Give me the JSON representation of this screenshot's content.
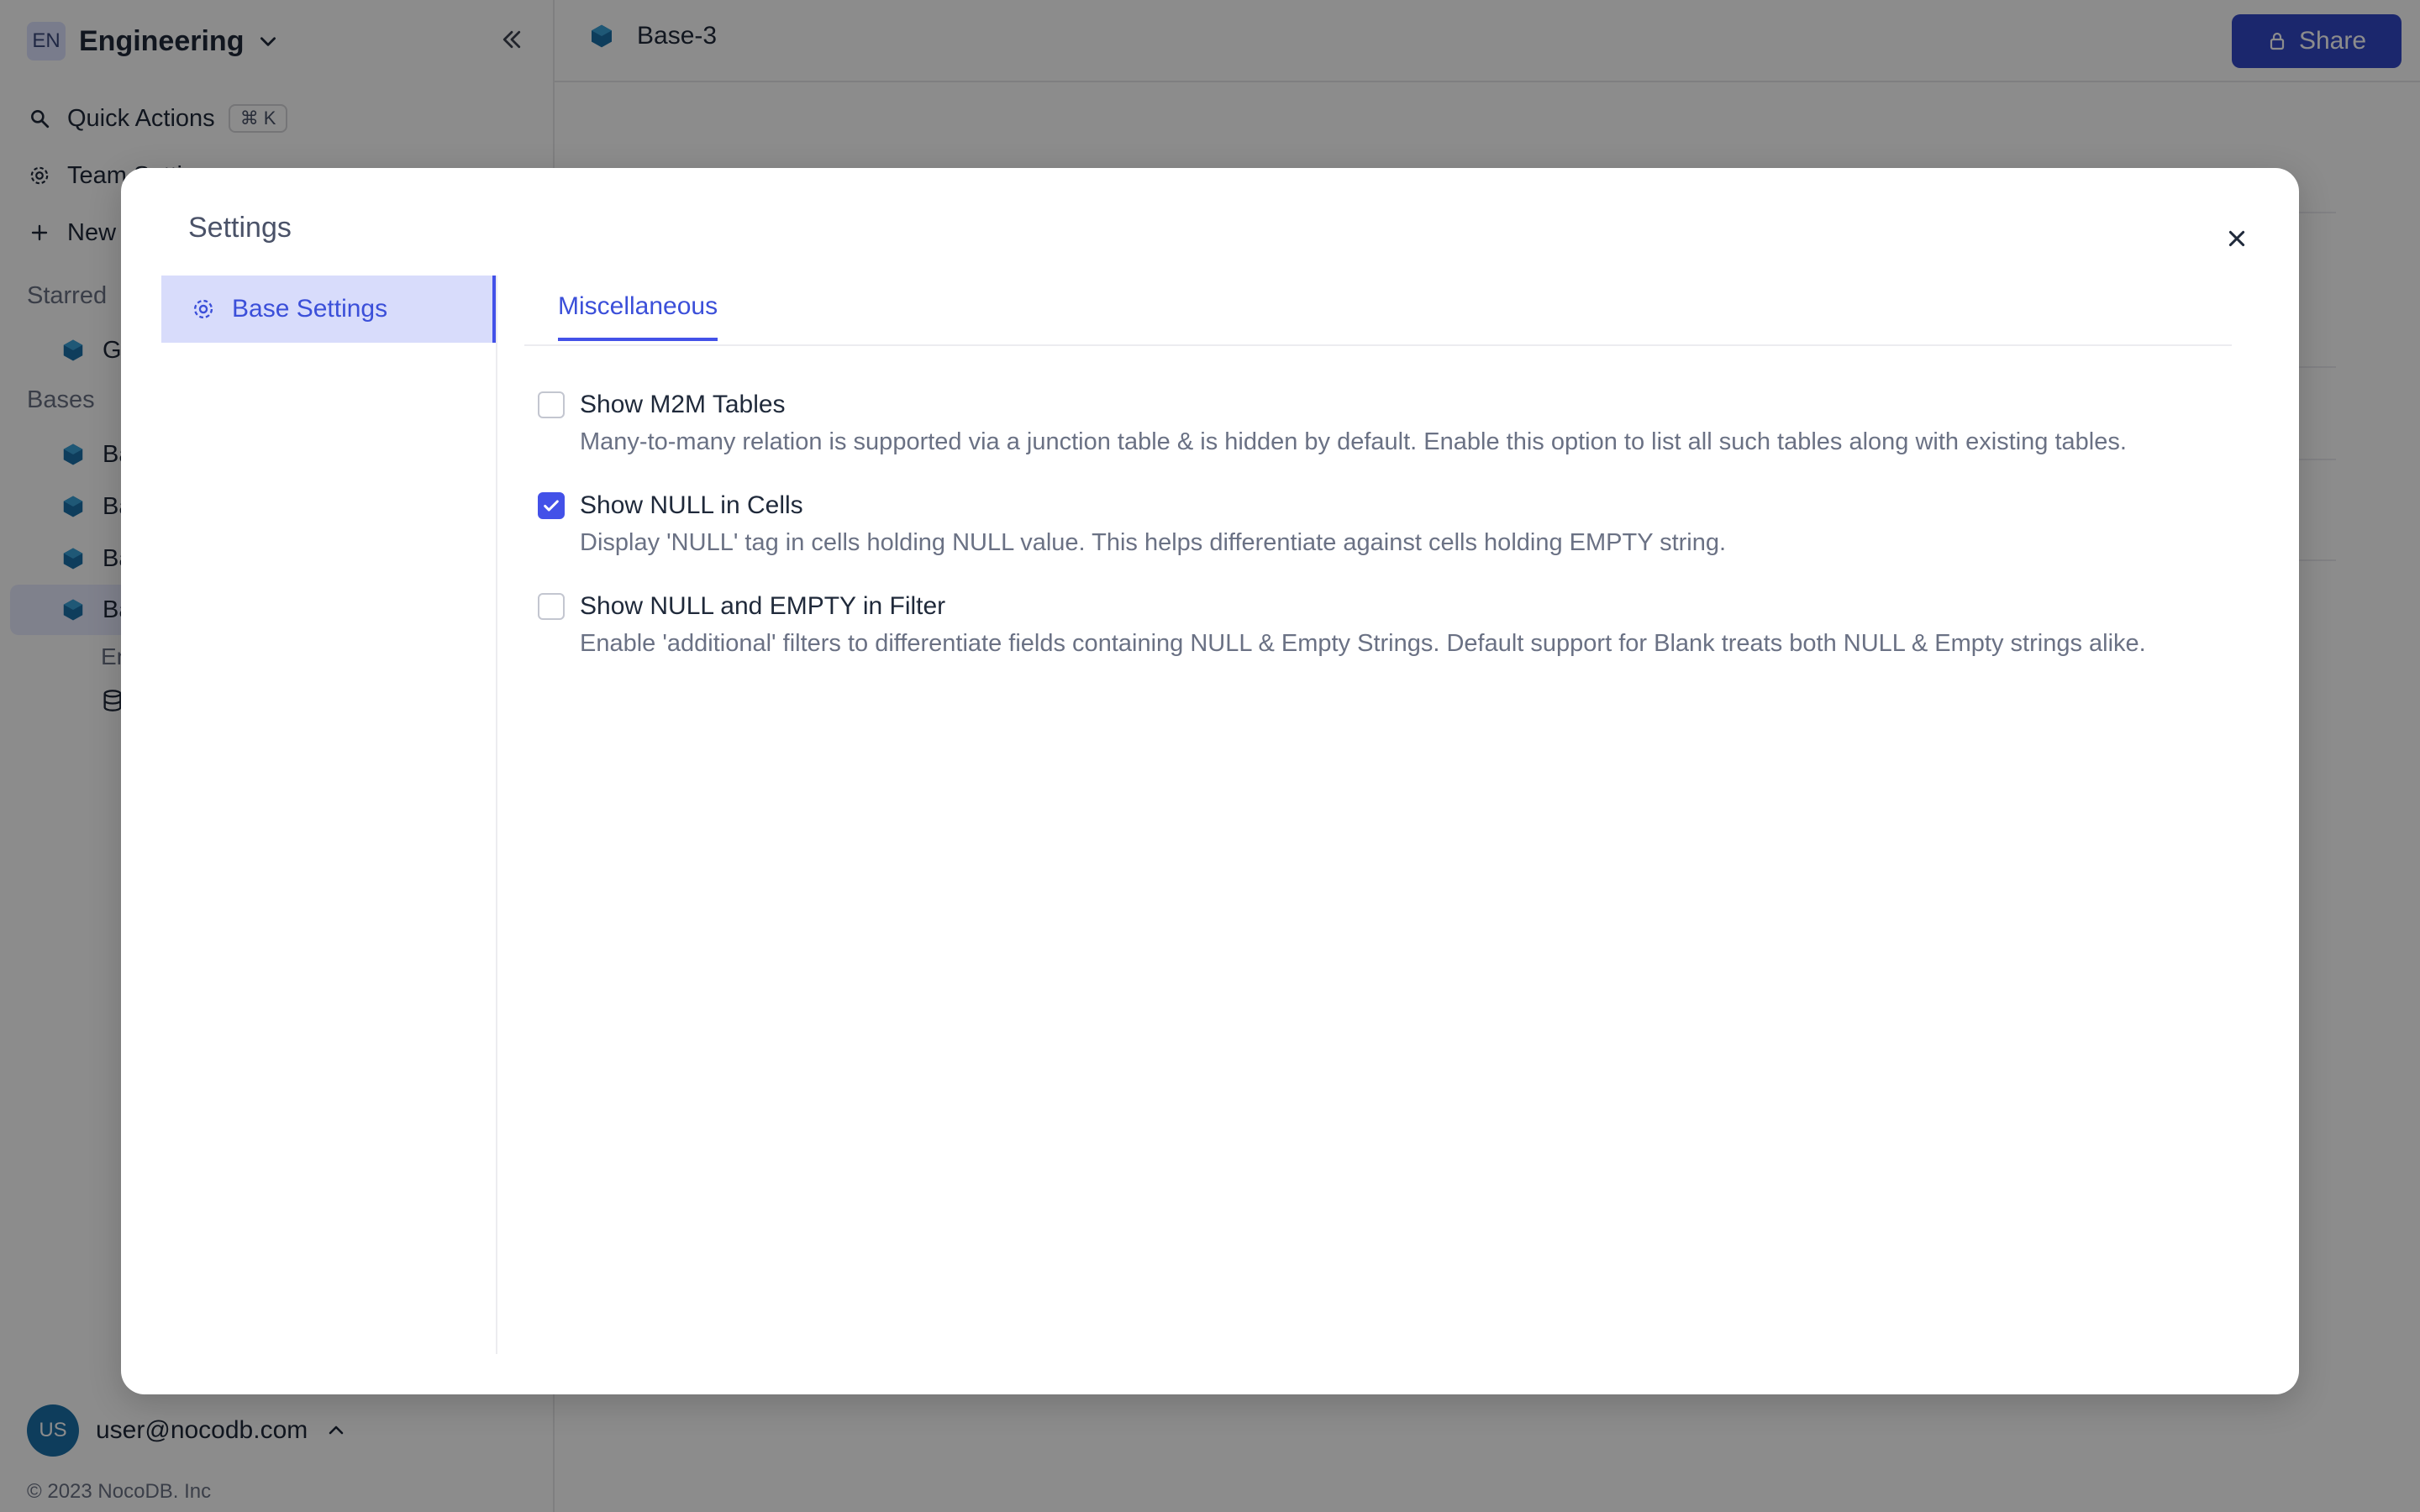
{
  "sidebar": {
    "workspace_initials": "EN",
    "workspace_name": "Engineering",
    "quick_actions_label": "Quick Actions",
    "quick_actions_shortcut": "⌘ K",
    "team_settings_label": "Team Settings",
    "new_label": "New",
    "starred_label": "Starred",
    "starred_item": "Ge",
    "bases_label": "Bases",
    "base_items": [
      "Ba",
      "Ba",
      "Ba",
      "Ba"
    ],
    "sub_item_1": "En",
    "user_initials": "US",
    "user_email": "user@nocodb.com",
    "copyright": "© 2023 NocoDB. Inc"
  },
  "topbar": {
    "base_title": "Base-3",
    "share_label": "Share"
  },
  "modal": {
    "title": "Settings",
    "nav_item": "Base Settings",
    "tab": "Miscellaneous",
    "options": [
      {
        "label": "Show M2M Tables",
        "checked": false,
        "description": "Many-to-many relation is supported via a junction table & is hidden by default. Enable this option to list all such tables along with existing tables."
      },
      {
        "label": "Show NULL in Cells",
        "checked": true,
        "description": "Display 'NULL' tag in cells holding NULL value. This helps differentiate against cells holding EMPTY string."
      },
      {
        "label": "Show NULL and EMPTY in Filter",
        "checked": false,
        "description": "Enable 'additional' filters to differentiate fields containing NULL & Empty Strings. Default support for Blank treats both NULL & Empty strings alike."
      }
    ]
  },
  "colors": {
    "accent": "#4351e8",
    "share_button": "#3247c6",
    "nav_active_bg": "#d8dcfb",
    "overlay": "rgba(0,0,0,0.45)"
  }
}
